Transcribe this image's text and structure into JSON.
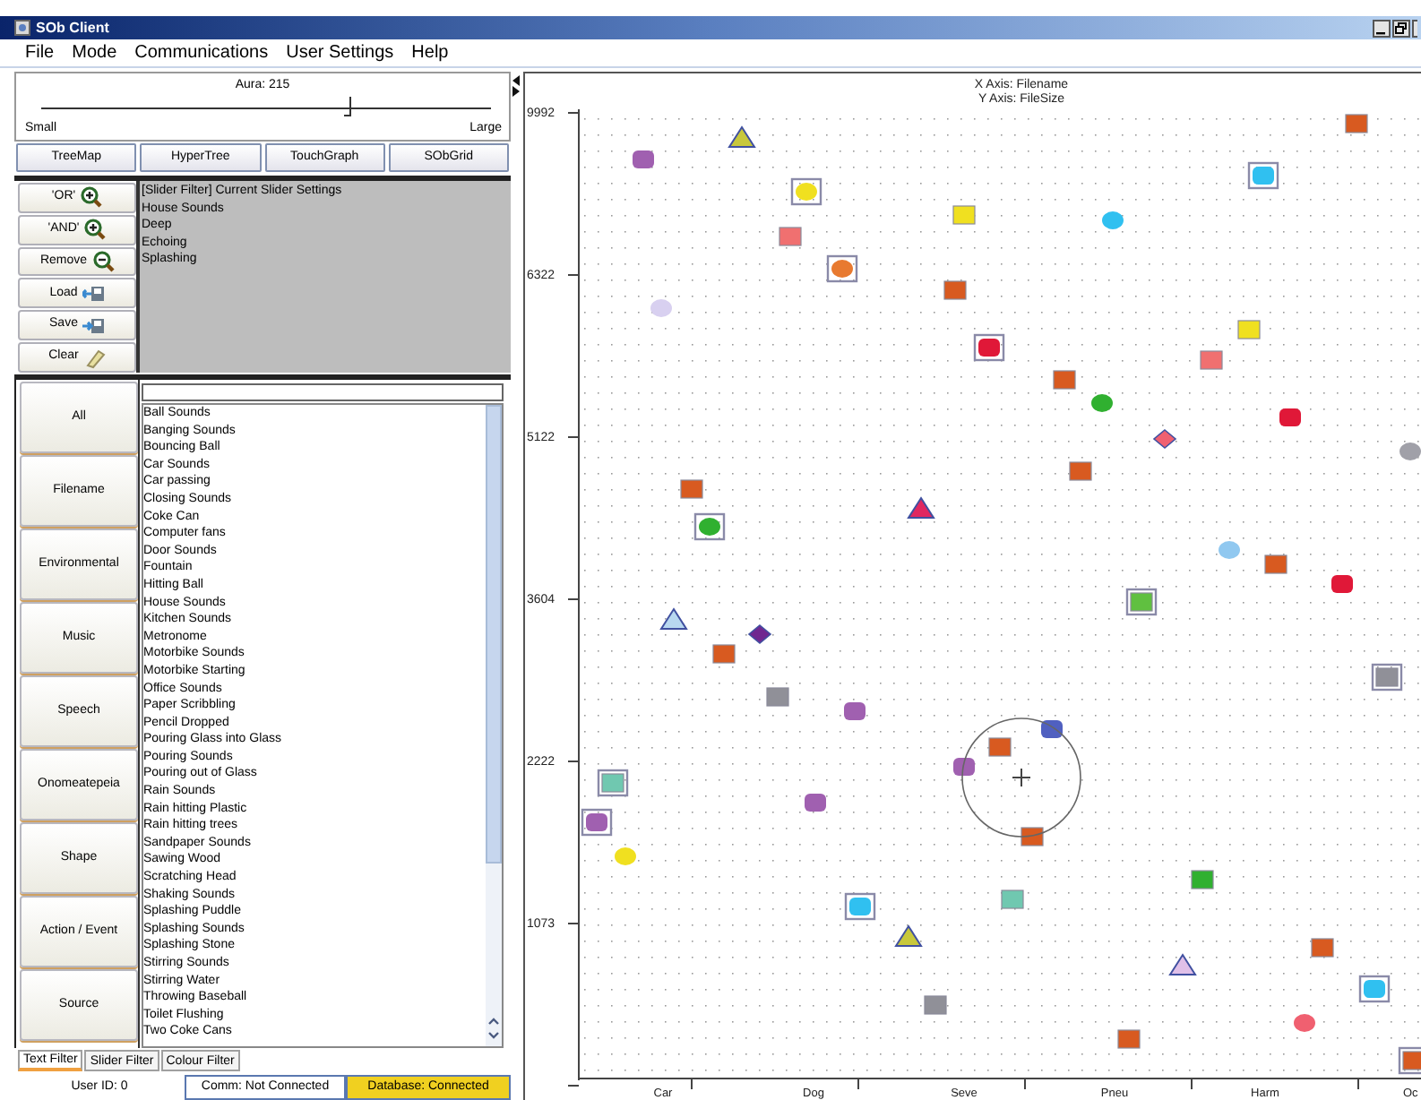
{
  "window": {
    "title": "SOb Client"
  },
  "menu": [
    "File",
    "Mode",
    "Communications",
    "User Settings",
    "Help"
  ],
  "aura_slider": {
    "label": "Aura: 215",
    "level": 0.69,
    "min_label": "Small",
    "max_label": "Large"
  },
  "view_buttons": [
    "TreeMap",
    "HyperTree",
    "TouchGraph",
    "SObGrid"
  ],
  "filter_buttons": [
    {
      "label": "'OR'",
      "kind": "zoom_in"
    },
    {
      "label": "'AND'",
      "kind": "zoom_in"
    },
    {
      "label": "Remove",
      "kind": "zoom_out"
    },
    {
      "label": "Load",
      "kind": "load"
    },
    {
      "label": "Save",
      "kind": "save"
    },
    {
      "label": "Clear",
      "kind": "clear"
    }
  ],
  "filter_settings": [
    "[Slider Filter] Current Slider Settings",
    "House Sounds",
    "Deep",
    "Echoing",
    "Splashing"
  ],
  "categories": [
    "All",
    "Filename",
    "Environmental",
    "Music",
    "Speech",
    "Onomeatepeia",
    "Shape",
    "Action / Event",
    "Source"
  ],
  "sound_list": [
    "Ball Sounds",
    "Banging Sounds",
    "Bouncing Ball",
    "Car Sounds",
    "Car passing",
    "Closing Sounds",
    "Coke Can",
    "Computer fans",
    "Door Sounds",
    "Fountain",
    "Hitting Ball",
    "House Sounds",
    "Kitchen Sounds",
    "Metronome",
    "Motorbike Sounds",
    "Motorbike Starting",
    "Office Sounds",
    "Paper Scribbling",
    "Pencil Dropped",
    "Pouring Glass into Glass",
    "Pouring Sounds",
    "Pouring out of Glass",
    "Rain Sounds",
    "Rain hitting Plastic",
    "Rain hitting trees",
    "Sandpaper Sounds",
    "Sawing Wood",
    "Scratching Head",
    "Shaking Sounds",
    "Splashing Puddle",
    "Splashing Sounds",
    "Splashing Stone",
    "Stirring Sounds",
    "Stirring Water",
    "Throwing Baseball",
    "Toilet Flushing",
    "Two Coke Cans"
  ],
  "tabs": [
    {
      "label": "Text Filter",
      "selected": true
    },
    {
      "label": "Slider Filter",
      "selected": false
    },
    {
      "label": "Colour Filter",
      "selected": false
    }
  ],
  "status_bar": {
    "user": "User ID: 0",
    "comm": "Comm: Not Connected",
    "database": "Database: Connected"
  },
  "chart": {
    "x_axis_title": "X Axis: Filename",
    "y_axis_title": "Y Axis: FileSize",
    "y_ticks": [
      "9992",
      "6322",
      "5122",
      "3604",
      "2222",
      "1073"
    ],
    "x_labels": [
      "Car",
      "Dog",
      "Seve",
      "Pneu",
      "Harm",
      "Oc"
    ]
  }
}
